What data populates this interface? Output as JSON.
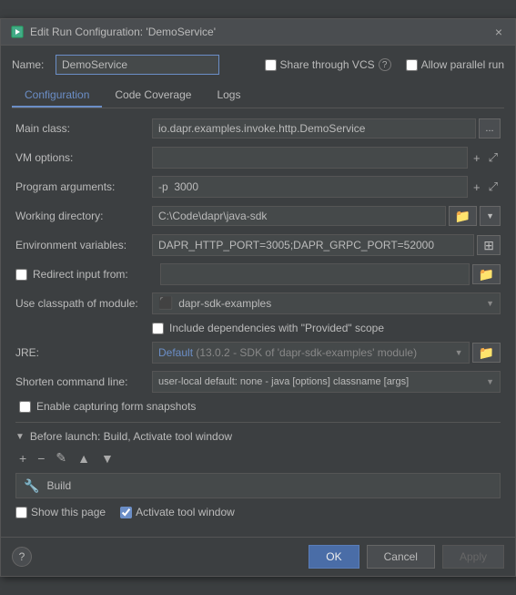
{
  "dialog": {
    "title": "Edit Run Configuration: 'DemoService'",
    "title_icon": "⚙",
    "close_label": "×"
  },
  "name_row": {
    "label": "Name:",
    "value": "DemoService",
    "share_label": "Share through VCS",
    "allow_parallel_label": "Allow parallel run",
    "help_icon": "?"
  },
  "tabs": [
    {
      "label": "Configuration",
      "active": true
    },
    {
      "label": "Code Coverage",
      "active": false
    },
    {
      "label": "Logs",
      "active": false
    }
  ],
  "form": {
    "main_class_label": "Main class:",
    "main_class_value": "io.dapr.examples.invoke.http.DemoService",
    "main_class_btn": "...",
    "vm_options_label": "VM options:",
    "vm_options_value": "",
    "program_args_label": "Program arguments:",
    "program_args_value": "-p  3000",
    "working_dir_label": "Working directory:",
    "working_dir_value": "C:\\Code\\dapr\\java-sdk",
    "env_vars_label": "Environment variables:",
    "env_vars_value": "DAPR_HTTP_PORT=3005;DAPR_GRPC_PORT=52000",
    "redirect_label": "Redirect input from:",
    "redirect_value": "",
    "use_classpath_label": "Use classpath of module:",
    "use_classpath_value": "dapr-sdk-examples",
    "include_deps_label": "Include dependencies with \"Provided\" scope",
    "jre_label": "JRE:",
    "jre_value_default": "Default",
    "jre_value_detail": "(13.0.2 - SDK of 'dapr-sdk-examples' module)",
    "shorten_label": "Shorten command line:",
    "shorten_value": "user-local default: none - java [options] classname [args]",
    "enable_snapshots_label": "Enable capturing form snapshots"
  },
  "before_launch": {
    "header": "Before launch: Build, Activate tool window",
    "build_item": "Build",
    "toolbar": {
      "add": "+",
      "remove": "−",
      "edit": "✎",
      "up": "▲",
      "down": "▼"
    }
  },
  "bottom_options": {
    "show_page_label": "Show this page",
    "activate_label": "Activate tool window"
  },
  "footer": {
    "ok_label": "OK",
    "cancel_label": "Cancel",
    "apply_label": "Apply",
    "help_label": "?"
  }
}
